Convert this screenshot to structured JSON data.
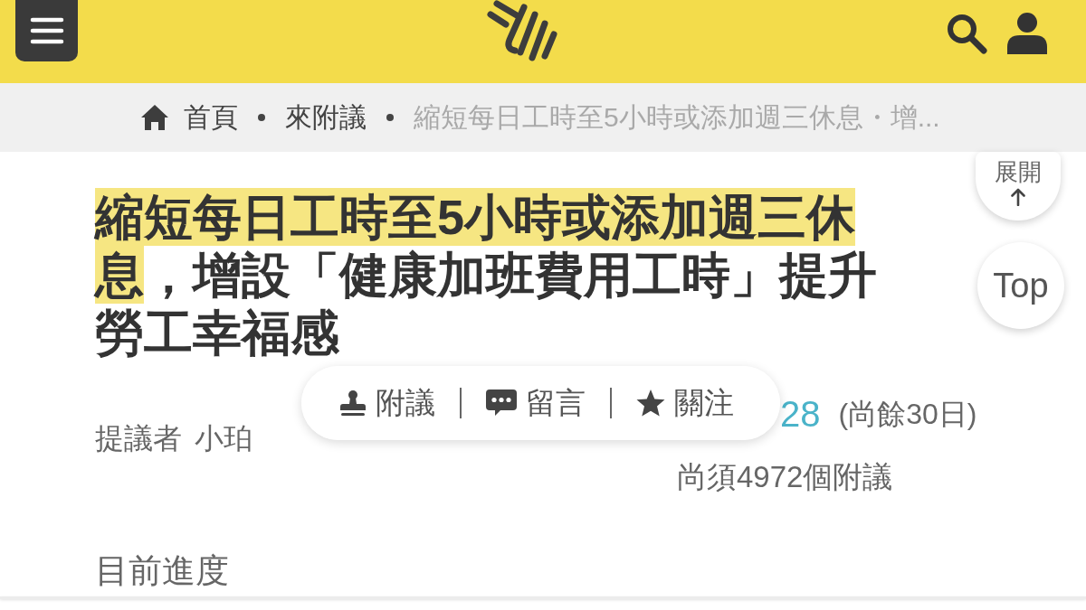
{
  "breadcrumb": [
    {
      "kind": "home",
      "label": "首頁"
    },
    {
      "kind": "link",
      "label": "來附議"
    },
    {
      "kind": "current",
      "label": "縮短每日工時至5小時或添加週三休息・增..."
    }
  ],
  "title": [
    {
      "text": "縮短每日工時至5小時或添加週三休息",
      "highlighted": true
    },
    {
      "text": "，增設「健康加班費用工時」提升勞工幸福感",
      "highlighted": false
    }
  ],
  "action_bar": [
    {
      "kind": "endorse",
      "label": "附議"
    },
    {
      "kind": "comment",
      "label": "留言"
    },
    {
      "kind": "follow",
      "label": "關注"
    }
  ],
  "proposer": {
    "label": "提議者",
    "name": "小珀"
  },
  "endorsements": {
    "count": "28",
    "remaining_days": "(尚餘30日)",
    "needed": "尚須4972個附議"
  },
  "progress": {
    "heading": "目前進度"
  },
  "side_buttons": [
    {
      "kind": "expand",
      "label": "展開"
    },
    {
      "kind": "top",
      "label": "Top"
    }
  ]
}
